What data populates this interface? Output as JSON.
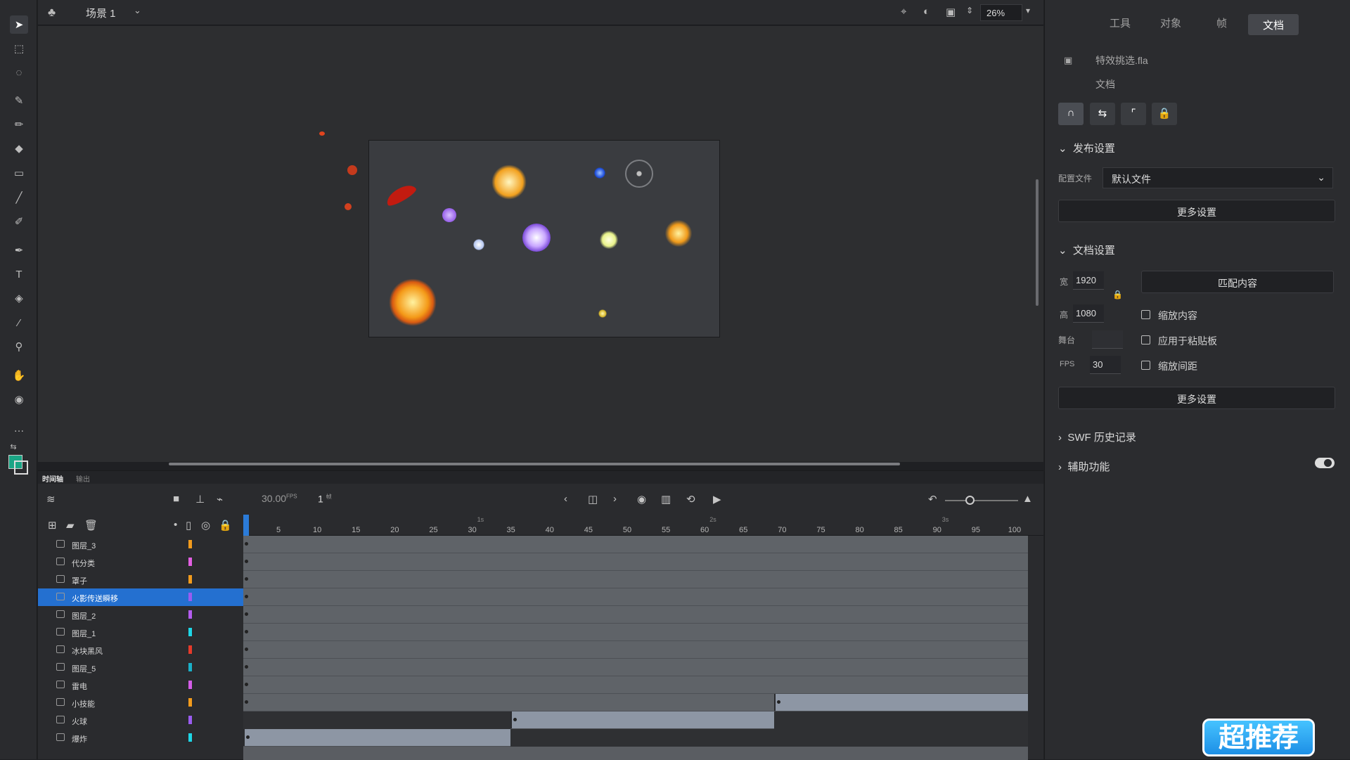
{
  "topbar": {
    "scene_label": "场景 1",
    "zoom_value": "26%"
  },
  "panel": {
    "tabs": [
      "工具",
      "对象",
      "帧",
      "文档"
    ],
    "active_tab": "文档",
    "file_name": "特效挑选.fla",
    "doc_label": "文档",
    "publish": {
      "title": "发布设置",
      "profile_label": "配置文件",
      "profile_value": "默认文件",
      "more_button": "更多设置"
    },
    "docset": {
      "title": "文档设置",
      "width_label": "宽",
      "width_value": "1920",
      "height_label": "高",
      "height_value": "1080",
      "stage_label": "舞台",
      "fps_label": "FPS",
      "fps_value": "30",
      "match_button": "匹配内容",
      "scale_content": "缩放内容",
      "apply_pasteboard": "应用于粘贴板",
      "scale_spacing": "缩放间距",
      "more_button": "更多设置"
    },
    "swf_history": "SWF 历史记录",
    "accessibility": "辅助功能"
  },
  "timeline": {
    "tabs": [
      "时间轴",
      "输出"
    ],
    "fps": "30.00",
    "fps_unit": "FPS",
    "frame": "1",
    "frame_unit": "帧",
    "ticks": [
      "5",
      "10",
      "15",
      "20",
      "25",
      "30",
      "35",
      "40",
      "45",
      "50",
      "55",
      "60",
      "65",
      "70",
      "75",
      "80",
      "85",
      "90",
      "95",
      "100"
    ],
    "seconds": [
      "1s",
      "2s",
      "3s"
    ],
    "layers": [
      {
        "name": "图层_3",
        "color": "#f29b1d"
      },
      {
        "name": "代分类",
        "color": "#e25fe2"
      },
      {
        "name": "罩子",
        "color": "#f29b1d"
      },
      {
        "name": "火影传送瞬移",
        "color": "#9a5cf0"
      },
      {
        "name": "图层_2",
        "color": "#b45cf0"
      },
      {
        "name": "图层_1",
        "color": "#1ed6e6"
      },
      {
        "name": "冰块黑风",
        "color": "#e63a2a"
      },
      {
        "name": "图层_5",
        "color": "#1ab0c8"
      },
      {
        "name": "雷电",
        "color": "#d45ce8"
      },
      {
        "name": "小技能",
        "color": "#f29b1d"
      },
      {
        "name": "火球",
        "color": "#9a5cf0"
      },
      {
        "name": "爆炸",
        "color": "#1ed6e6"
      }
    ],
    "selected_layer": "火影传送瞬移"
  },
  "badge_text": "超推荐"
}
